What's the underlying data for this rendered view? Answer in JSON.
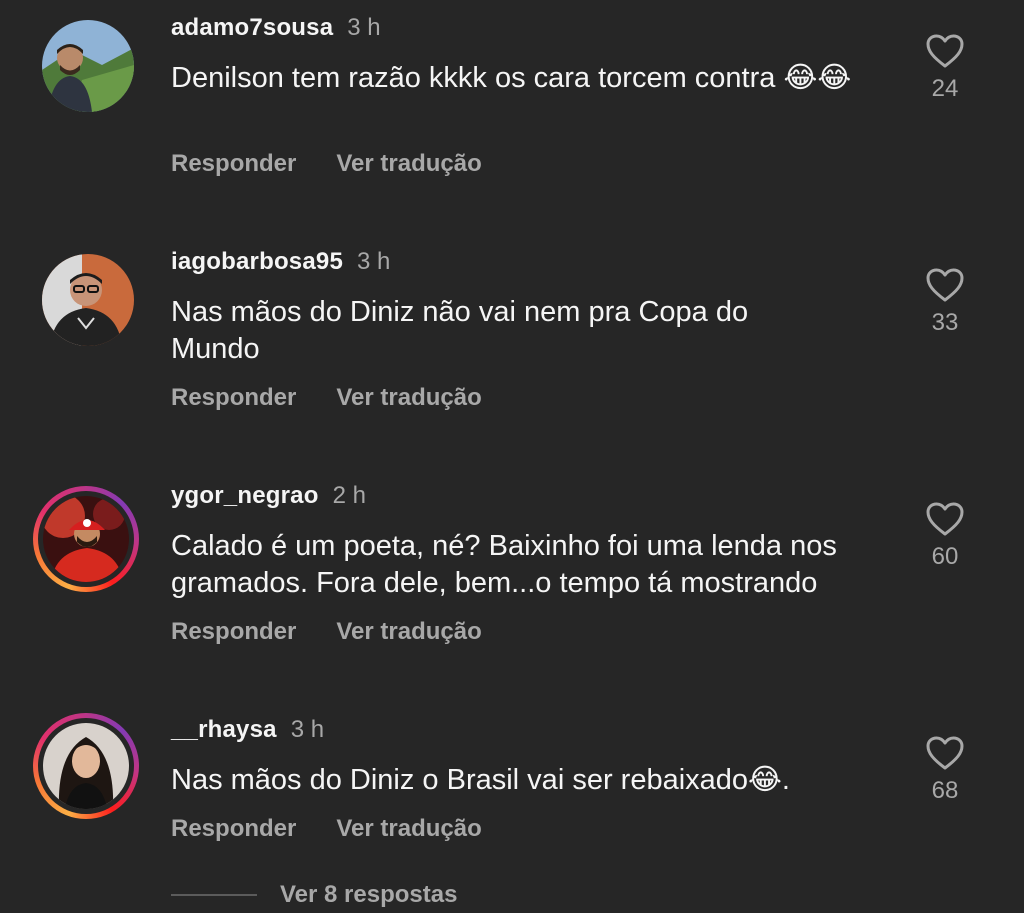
{
  "comments": [
    {
      "username": "adamo7sousa",
      "time": "3 h",
      "text": "Denilson tem razão kkkk os cara torcem contra 😂😂",
      "likes": "24",
      "reply_label": "Responder",
      "translate_label": "Ver tradução"
    },
    {
      "username": "iagobarbosa95",
      "time": "3 h",
      "text": "Nas mãos do Diniz não vai nem pra Copa do Mundo",
      "likes": "33",
      "reply_label": "Responder",
      "translate_label": "Ver tradução"
    },
    {
      "username": "ygor_negrao",
      "time": "2 h",
      "text": "Calado é um poeta, né? Baixinho foi uma lenda nos gramados. Fora dele, bem...o tempo tá mostrando",
      "likes": "60",
      "reply_label": "Responder",
      "translate_label": "Ver tradução"
    },
    {
      "username": "__rhaysa",
      "time": "3 h",
      "text": "Nas mãos do Diniz o Brasil vai ser rebaixado😂.",
      "likes": "68",
      "reply_label": "Responder",
      "translate_label": "Ver tradução"
    }
  ],
  "view_replies_label": "Ver 8 respostas",
  "icons": {
    "like": "heart-outline-icon"
  },
  "colors": {
    "background": "#262626",
    "primary_text": "#f5f5f5",
    "secondary_text": "#a8a8a8"
  }
}
